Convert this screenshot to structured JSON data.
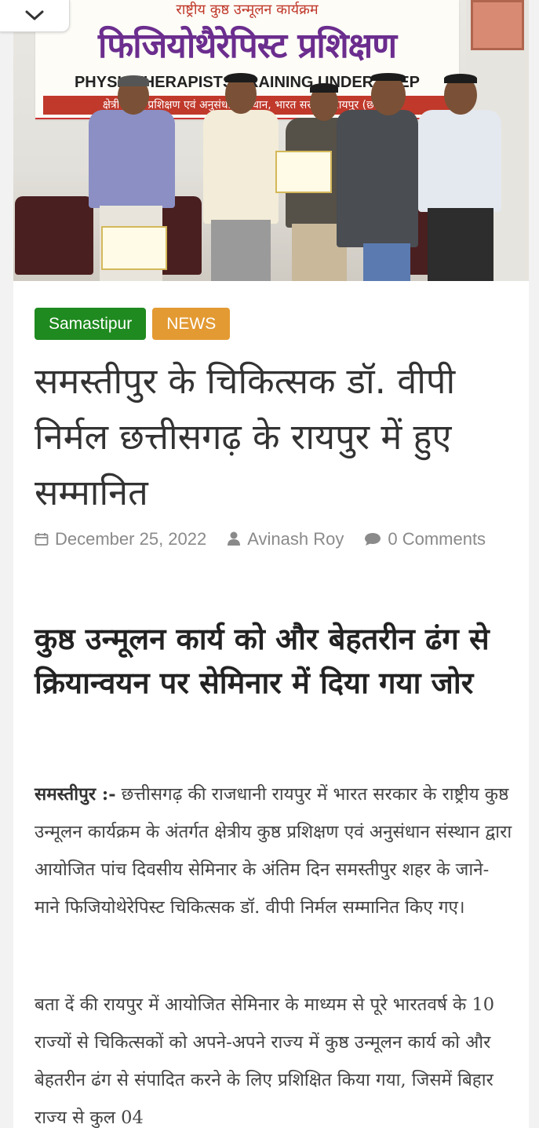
{
  "photo": {
    "banner_top": "राष्ट्रीय कुष्ठ उन्मूलन कार्यक्रम",
    "banner_title": "फिजियोथैरेपिस्ट प्रशिक्षण",
    "banner_sub": "PHYSIOTHERAPISTS TRAINING UNDER NLEP",
    "banner_strip": "क्षेत्रीय कुष्ठ प्रशिक्षण एवं अनुसंधान संस्थान, भारत सरकार, रायपुर (छ.ग.)"
  },
  "tags": [
    "Samastipur",
    "NEWS"
  ],
  "colors": {
    "tag_green": "#1f8a1f",
    "tag_orange": "#e39a33"
  },
  "headline": "समस्तीपुर के चिकित्सक डॉ. वीपी निर्मल छत्तीसगढ़ के रायपुर में हुए सम्मानित",
  "meta": {
    "date_icon": "calendar-icon",
    "date": "December 25, 2022",
    "author_icon": "user-icon",
    "author": "Avinash Roy",
    "comments_icon": "comment-icon",
    "comments": "0 Comments"
  },
  "subheadline": "कुष्ठ उन्मूलन कार्य को और बेहतरीन ढंग से क्रियान्वयन पर सेमिनार में दिया गया जोर",
  "article": {
    "dateline": "समस्तीपुर :-",
    "p1": " छत्तीसगढ़ की राजधानी रायपुर में भारत सरकार के राष्ट्रीय कुष्ठ उन्मूलन कार्यक्रम के अंतर्गत क्षेत्रीय कुष्ठ प्रशिक्षण एवं अनुसंधान संस्थान द्वारा आयोजित पांच दिवसीय सेमिनार के अंतिम दिन समस्तीपुर शहर के जाने-माने फिजियोथेरेपिस्ट चिकित्सक डॉ. वीपी निर्मल सम्मानित किए गए।",
    "p2": "बता दें की रायपुर में आयोजित सेमिनार के माध्यम से पूरे भारतवर्ष के 10 राज्यों से चिकित्सकों को अपने-अपने राज्य में कुष्ठ उन्मूलन कार्य को और बेहतरीन ढंग से संपादित करने के लिए प्रशिक्षित किया गया, जिसमें बिहार राज्य से कुल 04"
  }
}
